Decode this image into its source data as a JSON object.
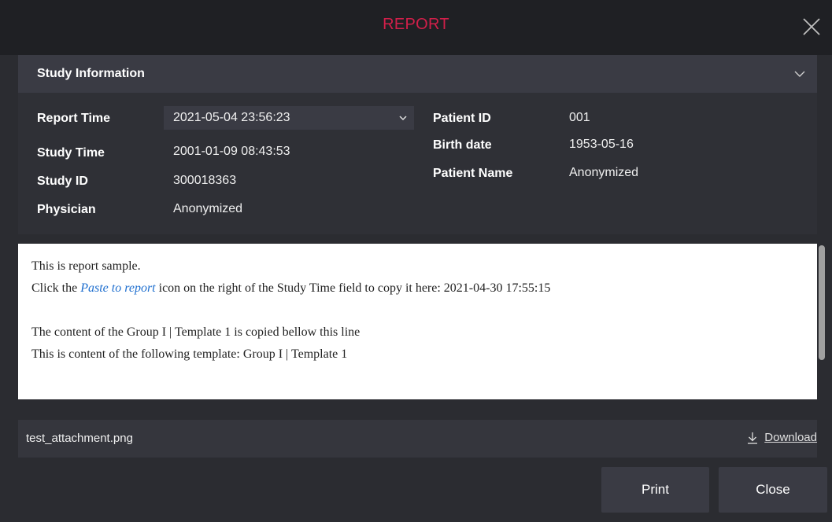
{
  "dialog": {
    "title": "REPORT"
  },
  "study_info": {
    "section_title": "Study Information",
    "left": [
      {
        "label": "Report Time",
        "value": "2021-05-04 23:56:23"
      },
      {
        "label": "Study Time",
        "value": "2001-01-09 08:43:53"
      },
      {
        "label": "Study ID",
        "value": "300018363"
      },
      {
        "label": "Physician",
        "value": "Anonymized"
      }
    ],
    "right": [
      {
        "label": "Patient ID",
        "value": "001"
      },
      {
        "label": "Birth date",
        "value": "1953-05-16"
      },
      {
        "label": "Patient Name",
        "value": "Anonymized"
      }
    ]
  },
  "report": {
    "line1": "This is report sample.",
    "line2_prefix": "Click the ",
    "line2_link": "Paste to report",
    "line2_suffix": " icon on the right of the Study Time field to copy it here: 2021-04-30 17:55:15",
    "line3": "The content of the Group I | Template 1 is copied bellow this line",
    "line4": "This is content of the following template: Group I | Template 1"
  },
  "attachment": {
    "filename": "test_attachment.png",
    "download_label": "Download"
  },
  "buttons": {
    "print": "Print",
    "close": "Close"
  },
  "colors": {
    "title": "#d21f4a",
    "link": "#1f6fcf",
    "background": "#2b2c31"
  },
  "icons": {
    "close": "close-icon",
    "collapse": "chevron-down-icon",
    "dropdown": "chevron-down-icon",
    "download": "download-icon"
  }
}
